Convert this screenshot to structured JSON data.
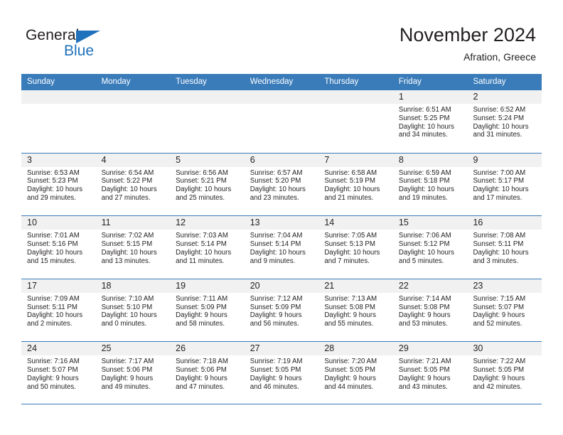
{
  "brand": {
    "name_part1": "General",
    "name_part2": "Blue",
    "accent_color": "#1f72bb"
  },
  "header": {
    "title": "November 2024",
    "subtitle": "Afration, Greece"
  },
  "calendar": {
    "header_color": "#3a7cba",
    "day_band_color": "#f1f1f1",
    "weekdays": [
      "Sunday",
      "Monday",
      "Tuesday",
      "Wednesday",
      "Thursday",
      "Friday",
      "Saturday"
    ],
    "weeks": [
      [
        {
          "day": "",
          "sunrise": "",
          "sunset": "",
          "daylight_line1": "",
          "daylight_line2": ""
        },
        {
          "day": "",
          "sunrise": "",
          "sunset": "",
          "daylight_line1": "",
          "daylight_line2": ""
        },
        {
          "day": "",
          "sunrise": "",
          "sunset": "",
          "daylight_line1": "",
          "daylight_line2": ""
        },
        {
          "day": "",
          "sunrise": "",
          "sunset": "",
          "daylight_line1": "",
          "daylight_line2": ""
        },
        {
          "day": "",
          "sunrise": "",
          "sunset": "",
          "daylight_line1": "",
          "daylight_line2": ""
        },
        {
          "day": "1",
          "sunrise": "Sunrise: 6:51 AM",
          "sunset": "Sunset: 5:25 PM",
          "daylight_line1": "Daylight: 10 hours",
          "daylight_line2": "and 34 minutes."
        },
        {
          "day": "2",
          "sunrise": "Sunrise: 6:52 AM",
          "sunset": "Sunset: 5:24 PM",
          "daylight_line1": "Daylight: 10 hours",
          "daylight_line2": "and 31 minutes."
        }
      ],
      [
        {
          "day": "3",
          "sunrise": "Sunrise: 6:53 AM",
          "sunset": "Sunset: 5:23 PM",
          "daylight_line1": "Daylight: 10 hours",
          "daylight_line2": "and 29 minutes."
        },
        {
          "day": "4",
          "sunrise": "Sunrise: 6:54 AM",
          "sunset": "Sunset: 5:22 PM",
          "daylight_line1": "Daylight: 10 hours",
          "daylight_line2": "and 27 minutes."
        },
        {
          "day": "5",
          "sunrise": "Sunrise: 6:56 AM",
          "sunset": "Sunset: 5:21 PM",
          "daylight_line1": "Daylight: 10 hours",
          "daylight_line2": "and 25 minutes."
        },
        {
          "day": "6",
          "sunrise": "Sunrise: 6:57 AM",
          "sunset": "Sunset: 5:20 PM",
          "daylight_line1": "Daylight: 10 hours",
          "daylight_line2": "and 23 minutes."
        },
        {
          "day": "7",
          "sunrise": "Sunrise: 6:58 AM",
          "sunset": "Sunset: 5:19 PM",
          "daylight_line1": "Daylight: 10 hours",
          "daylight_line2": "and 21 minutes."
        },
        {
          "day": "8",
          "sunrise": "Sunrise: 6:59 AM",
          "sunset": "Sunset: 5:18 PM",
          "daylight_line1": "Daylight: 10 hours",
          "daylight_line2": "and 19 minutes."
        },
        {
          "day": "9",
          "sunrise": "Sunrise: 7:00 AM",
          "sunset": "Sunset: 5:17 PM",
          "daylight_line1": "Daylight: 10 hours",
          "daylight_line2": "and 17 minutes."
        }
      ],
      [
        {
          "day": "10",
          "sunrise": "Sunrise: 7:01 AM",
          "sunset": "Sunset: 5:16 PM",
          "daylight_line1": "Daylight: 10 hours",
          "daylight_line2": "and 15 minutes."
        },
        {
          "day": "11",
          "sunrise": "Sunrise: 7:02 AM",
          "sunset": "Sunset: 5:15 PM",
          "daylight_line1": "Daylight: 10 hours",
          "daylight_line2": "and 13 minutes."
        },
        {
          "day": "12",
          "sunrise": "Sunrise: 7:03 AM",
          "sunset": "Sunset: 5:14 PM",
          "daylight_line1": "Daylight: 10 hours",
          "daylight_line2": "and 11 minutes."
        },
        {
          "day": "13",
          "sunrise": "Sunrise: 7:04 AM",
          "sunset": "Sunset: 5:14 PM",
          "daylight_line1": "Daylight: 10 hours",
          "daylight_line2": "and 9 minutes."
        },
        {
          "day": "14",
          "sunrise": "Sunrise: 7:05 AM",
          "sunset": "Sunset: 5:13 PM",
          "daylight_line1": "Daylight: 10 hours",
          "daylight_line2": "and 7 minutes."
        },
        {
          "day": "15",
          "sunrise": "Sunrise: 7:06 AM",
          "sunset": "Sunset: 5:12 PM",
          "daylight_line1": "Daylight: 10 hours",
          "daylight_line2": "and 5 minutes."
        },
        {
          "day": "16",
          "sunrise": "Sunrise: 7:08 AM",
          "sunset": "Sunset: 5:11 PM",
          "daylight_line1": "Daylight: 10 hours",
          "daylight_line2": "and 3 minutes."
        }
      ],
      [
        {
          "day": "17",
          "sunrise": "Sunrise: 7:09 AM",
          "sunset": "Sunset: 5:11 PM",
          "daylight_line1": "Daylight: 10 hours",
          "daylight_line2": "and 2 minutes."
        },
        {
          "day": "18",
          "sunrise": "Sunrise: 7:10 AM",
          "sunset": "Sunset: 5:10 PM",
          "daylight_line1": "Daylight: 10 hours",
          "daylight_line2": "and 0 minutes."
        },
        {
          "day": "19",
          "sunrise": "Sunrise: 7:11 AM",
          "sunset": "Sunset: 5:09 PM",
          "daylight_line1": "Daylight: 9 hours",
          "daylight_line2": "and 58 minutes."
        },
        {
          "day": "20",
          "sunrise": "Sunrise: 7:12 AM",
          "sunset": "Sunset: 5:09 PM",
          "daylight_line1": "Daylight: 9 hours",
          "daylight_line2": "and 56 minutes."
        },
        {
          "day": "21",
          "sunrise": "Sunrise: 7:13 AM",
          "sunset": "Sunset: 5:08 PM",
          "daylight_line1": "Daylight: 9 hours",
          "daylight_line2": "and 55 minutes."
        },
        {
          "day": "22",
          "sunrise": "Sunrise: 7:14 AM",
          "sunset": "Sunset: 5:08 PM",
          "daylight_line1": "Daylight: 9 hours",
          "daylight_line2": "and 53 minutes."
        },
        {
          "day": "23",
          "sunrise": "Sunrise: 7:15 AM",
          "sunset": "Sunset: 5:07 PM",
          "daylight_line1": "Daylight: 9 hours",
          "daylight_line2": "and 52 minutes."
        }
      ],
      [
        {
          "day": "24",
          "sunrise": "Sunrise: 7:16 AM",
          "sunset": "Sunset: 5:07 PM",
          "daylight_line1": "Daylight: 9 hours",
          "daylight_line2": "and 50 minutes."
        },
        {
          "day": "25",
          "sunrise": "Sunrise: 7:17 AM",
          "sunset": "Sunset: 5:06 PM",
          "daylight_line1": "Daylight: 9 hours",
          "daylight_line2": "and 49 minutes."
        },
        {
          "day": "26",
          "sunrise": "Sunrise: 7:18 AM",
          "sunset": "Sunset: 5:06 PM",
          "daylight_line1": "Daylight: 9 hours",
          "daylight_line2": "and 47 minutes."
        },
        {
          "day": "27",
          "sunrise": "Sunrise: 7:19 AM",
          "sunset": "Sunset: 5:05 PM",
          "daylight_line1": "Daylight: 9 hours",
          "daylight_line2": "and 46 minutes."
        },
        {
          "day": "28",
          "sunrise": "Sunrise: 7:20 AM",
          "sunset": "Sunset: 5:05 PM",
          "daylight_line1": "Daylight: 9 hours",
          "daylight_line2": "and 44 minutes."
        },
        {
          "day": "29",
          "sunrise": "Sunrise: 7:21 AM",
          "sunset": "Sunset: 5:05 PM",
          "daylight_line1": "Daylight: 9 hours",
          "daylight_line2": "and 43 minutes."
        },
        {
          "day": "30",
          "sunrise": "Sunrise: 7:22 AM",
          "sunset": "Sunset: 5:05 PM",
          "daylight_line1": "Daylight: 9 hours",
          "daylight_line2": "and 42 minutes."
        }
      ]
    ]
  }
}
